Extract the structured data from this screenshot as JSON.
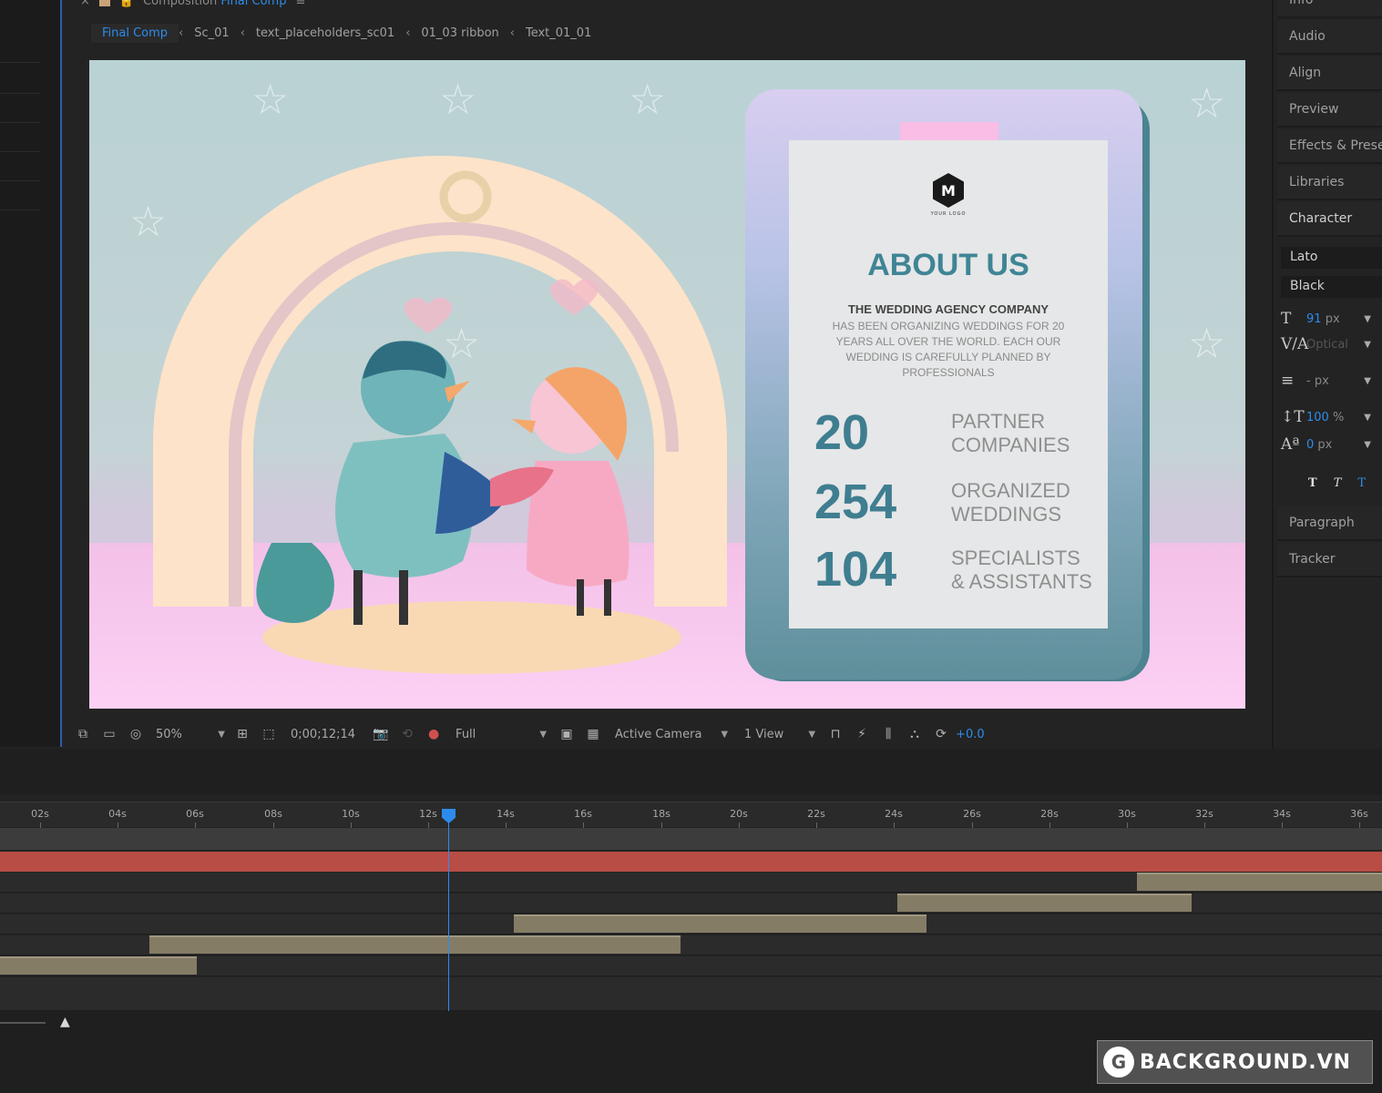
{
  "composition": {
    "panel_title": "Composition",
    "comp_name": "Final Comp",
    "menu_icon": "hamburger-icon",
    "breadcrumbs": [
      "Final Comp",
      "Sc_01",
      "text_placeholders_sc01",
      "01_03 ribbon",
      "Text_01_01"
    ]
  },
  "viewer": {
    "card": {
      "logo_letter": "M",
      "logo_caption": "YOUR LOGO",
      "title": "ABOUT US",
      "heading": "THE WEDDING AGENCY COMPANY",
      "body": "HAS BEEN ORGANIZING WEDDINGS FOR 20 YEARS ALL OVER THE WORLD. EACH OUR WEDDING IS CAREFULLY PLANNED BY PROFESSIONALS",
      "stats": [
        {
          "number": "20",
          "line1": "PARTNER",
          "line2": "COMPANIES"
        },
        {
          "number": "254",
          "line1": "ORGANIZED",
          "line2": "WEDDINGS"
        },
        {
          "number": "104",
          "line1": "SPECIALISTS",
          "line2": "& ASSISTANTS"
        }
      ]
    }
  },
  "toolbar": {
    "zoom": "50%",
    "timecode": "0;00;12;14",
    "resolution": "Full",
    "camera": "Active Camera",
    "views": "1 View",
    "exposure": "+0.0"
  },
  "right_panel": {
    "items_top": [
      "Info",
      "Audio",
      "Align",
      "Preview",
      "Effects & Presets",
      "Libraries"
    ],
    "character": "Character",
    "font_family": "Lato",
    "font_style": "Black",
    "font_size": "91",
    "font_size_unit": "px",
    "kerning": "Optical",
    "leading_value": "-",
    "leading_unit": "px",
    "vertical_scale": "100",
    "vertical_scale_unit": "%",
    "baseline_shift": "0",
    "baseline_unit": "px",
    "items_bottom": [
      "Paragraph",
      "Tracker"
    ]
  },
  "timeline": {
    "ruler_labels": [
      "02s",
      "04s",
      "06s",
      "08s",
      "10s",
      "12s",
      "14s",
      "16s",
      "18s",
      "20s",
      "22s",
      "24s",
      "26s",
      "28s",
      "30s",
      "32s",
      "34s",
      "36s"
    ],
    "current_time_label": "12s"
  },
  "watermark": {
    "text": "BACKGROUND.VN"
  },
  "colors": {
    "accent": "#2d8ceb",
    "card_teal": "#3f8595",
    "red_track": "#b84d45",
    "layer_bar": "#857c66"
  }
}
